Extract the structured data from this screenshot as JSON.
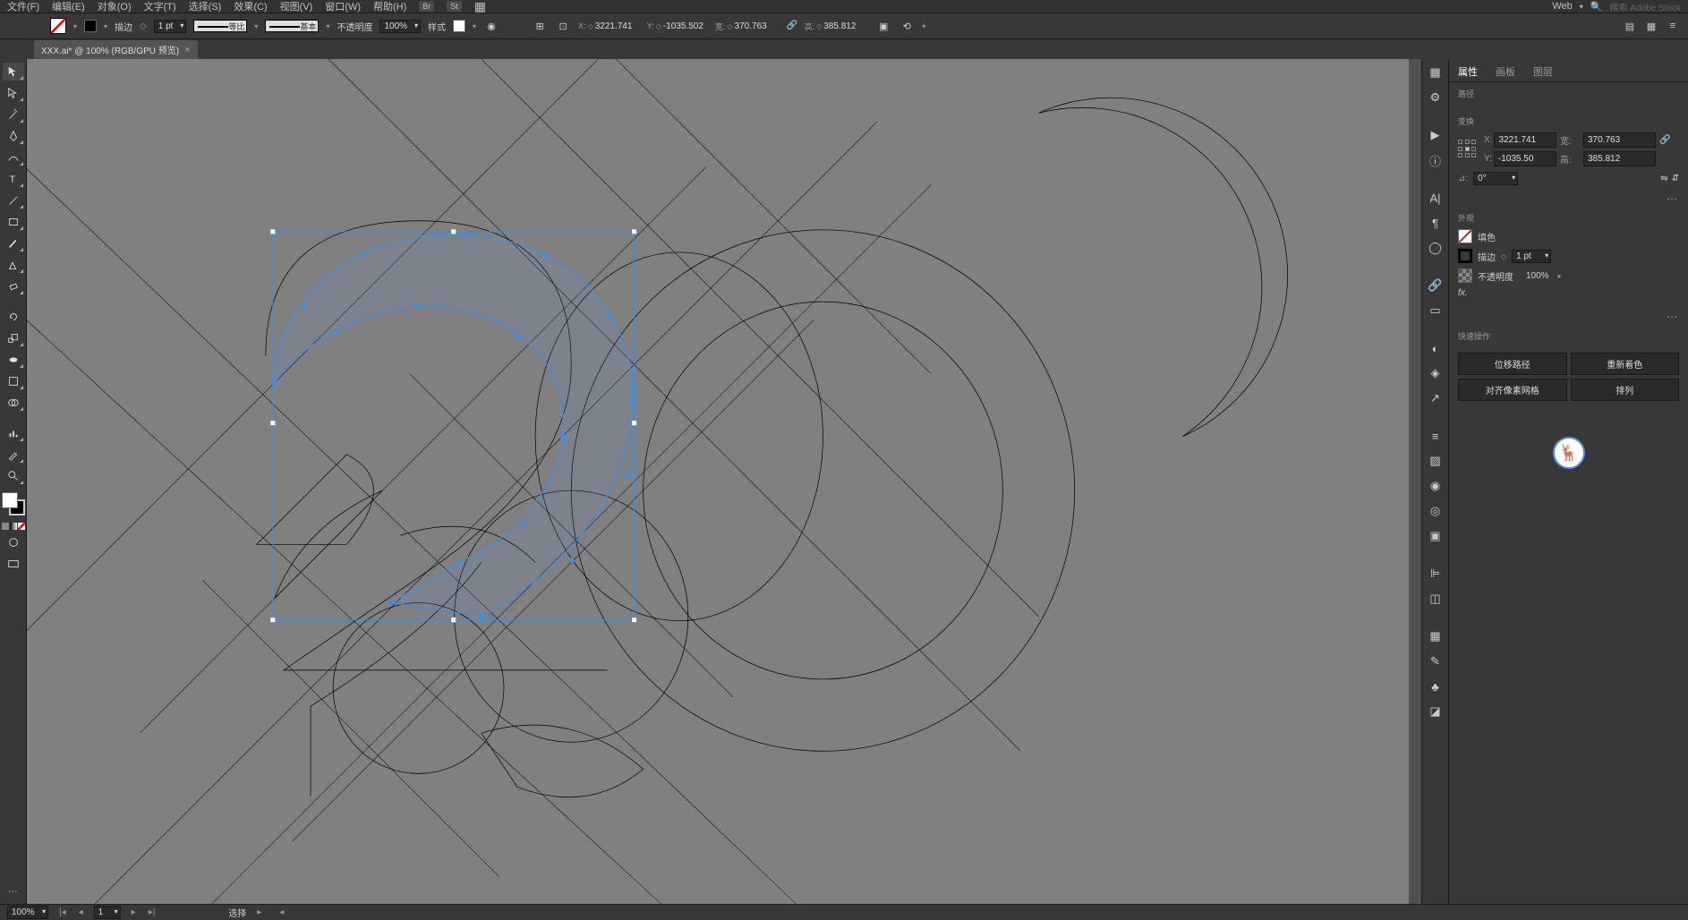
{
  "menubar": {
    "items": [
      "文件(F)",
      "编辑(E)",
      "对象(O)",
      "文字(T)",
      "选择(S)",
      "效果(C)",
      "视图(V)",
      "窗口(W)",
      "帮助(H)"
    ],
    "workspace": "Web",
    "search_placeholder": "搜索 Adobe Stock"
  },
  "controlbar": {
    "stroke_label": "描边",
    "stroke_weight": "1 pt",
    "profile_label": "等比",
    "brush_label": "基本",
    "opacity_label": "不透明度",
    "opacity": "100%",
    "style_label": "样式",
    "coords": {
      "x_label": "X:",
      "x": "3221.741",
      "y_label": "Y:",
      "y": "-1035.502",
      "w_label": "宽:",
      "w": "370.763",
      "h_label": "高:",
      "h": "385.812"
    }
  },
  "tab": {
    "title": "XXX.ai* @ 100% (RGB/GPU 预览)"
  },
  "panels": {
    "tabs": [
      "属性",
      "画板",
      "图层"
    ],
    "path_label": "路径",
    "transform": {
      "label": "变换",
      "x_label": "X:",
      "x": "3221.741",
      "y_label": "Y:",
      "y": "-1035.50",
      "w_label": "宽:",
      "w": "370.763",
      "h_label": "高:",
      "h": "385.812",
      "angle_label": "⊿:",
      "angle": "0°"
    },
    "appearance": {
      "label": "外观",
      "fill_label": "填色",
      "stroke_label": "描边",
      "stroke_weight": "1 pt",
      "opacity_label": "不透明度",
      "opacity": "100%",
      "fx_label": "fx."
    },
    "quickactions": {
      "label": "快速操作",
      "offset_path": "位移路径",
      "recolor": "重新着色",
      "align_pixel": "对齐像素网格",
      "arrange": "排列"
    }
  },
  "statusbar": {
    "zoom": "100%",
    "artboard": "1",
    "tool": "选择"
  }
}
